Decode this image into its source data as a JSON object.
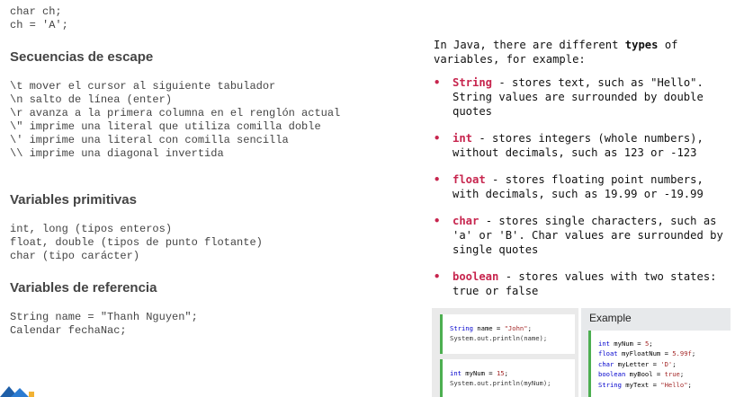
{
  "left": {
    "top_code": [
      "char ch;",
      "ch = 'A';"
    ],
    "escape": {
      "heading": "Secuencias de escape",
      "lines": [
        "\\t mover el cursor al siguiente tabulador",
        "\\n salto de línea (enter)",
        "\\r avanza a la primera columna en el renglón actual",
        "\\\" imprime una literal que utiliza comilla doble",
        "\\' imprime una literal con comilla sencilla",
        "\\\\ imprime una diagonal invertida"
      ]
    },
    "primitive": {
      "heading": "Variables primitivas",
      "lines": [
        "int, long (tipos enteros)",
        "float, double (tipos de punto flotante)",
        "char (tipo carácter)"
      ]
    },
    "reference": {
      "heading": "Variables de referencia",
      "lines": [
        "String name = \"Thanh Nguyen\";",
        "Calendar fechaNac;"
      ]
    }
  },
  "right": {
    "intro_pre": "In Java, there are different ",
    "intro_bold": "types",
    "intro_post": " of variables, for example:",
    "types": [
      {
        "kw": "String",
        "desc": " - stores text, such as \"Hello\". String values are surrounded by double quotes"
      },
      {
        "kw": "int",
        "desc": " - stores integers (whole numbers), without decimals, such as 123 or -123"
      },
      {
        "kw": "float",
        "desc": " - stores floating point numbers, with decimals, such as 19.99 or -19.99"
      },
      {
        "kw": "char",
        "desc": " - stores single characters, such as 'a' or 'B'. Char values are surrounded by single quotes"
      },
      {
        "kw": "boolean",
        "desc": " - stores values with two states: true or false"
      }
    ],
    "bullet": "•",
    "example_title": "Example",
    "box1": {
      "l1_type": "String",
      "l1_rest": " name = ",
      "l1_val": "\"John\"",
      "l1_end": ";",
      "l2": "System.out.println(name);"
    },
    "box2": {
      "l1_type": "int",
      "l1_rest": " myNum = ",
      "l1_val": "15",
      "l1_end": ";",
      "l2": "System.out.println(myNum);"
    },
    "box3": {
      "lines": [
        {
          "t": "int",
          "r": " myNum = ",
          "v": "5",
          "e": ";"
        },
        {
          "t": "float",
          "r": " myFloatNum = ",
          "v": "5.99f",
          "e": ";"
        },
        {
          "t": "char",
          "r": " myLetter = ",
          "v": "'D'",
          "e": ";"
        },
        {
          "t": "boolean",
          "r": " myBool = ",
          "v": "true",
          "e": ";"
        },
        {
          "t": "String",
          "r": " myText = ",
          "v": "\"Hello\"",
          "e": ";"
        }
      ]
    }
  },
  "colors": {
    "keyword": "#c7254e",
    "code_border": "#4caf50",
    "panel": "#e7e9eb"
  },
  "icons": {
    "logo": "logo-icon"
  }
}
